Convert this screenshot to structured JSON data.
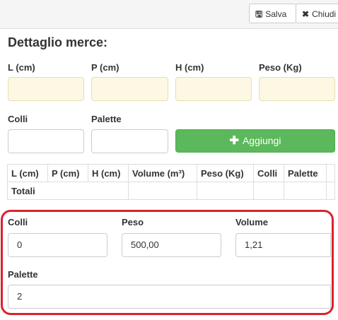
{
  "toolbar": {
    "save_label": "Salva",
    "save_icon": "save-icon",
    "close_label": "Chiudi",
    "close_icon": "close-icon"
  },
  "title": "Dettaglio merce:",
  "form": {
    "l_label": "L (cm)",
    "p_label": "P (cm)",
    "h_label": "H (cm)",
    "peso_label": "Peso (Kg)",
    "colli_label": "Colli",
    "palette_label": "Palette",
    "add_button_label": "Aggiungi",
    "l_value": "",
    "p_value": "",
    "h_value": "",
    "peso_value": "",
    "colli_value": "",
    "palette_value": ""
  },
  "table": {
    "headers": [
      "L (cm)",
      "P (cm)",
      "H (cm)",
      "Volume (m³)",
      "Peso (Kg)",
      "Colli",
      "Palette"
    ],
    "totals_label": "Totali"
  },
  "summary": {
    "colli_label": "Colli",
    "colli_value": "0",
    "peso_label": "Peso",
    "peso_value": "500,00",
    "volume_label": "Volume",
    "volume_value": "1,21",
    "palette_label": "Palette",
    "palette_value": "2"
  },
  "colors": {
    "required_field_bg": "#fcf8e3",
    "add_button": "#5cb85c",
    "highlight_border": "#d9232d"
  }
}
